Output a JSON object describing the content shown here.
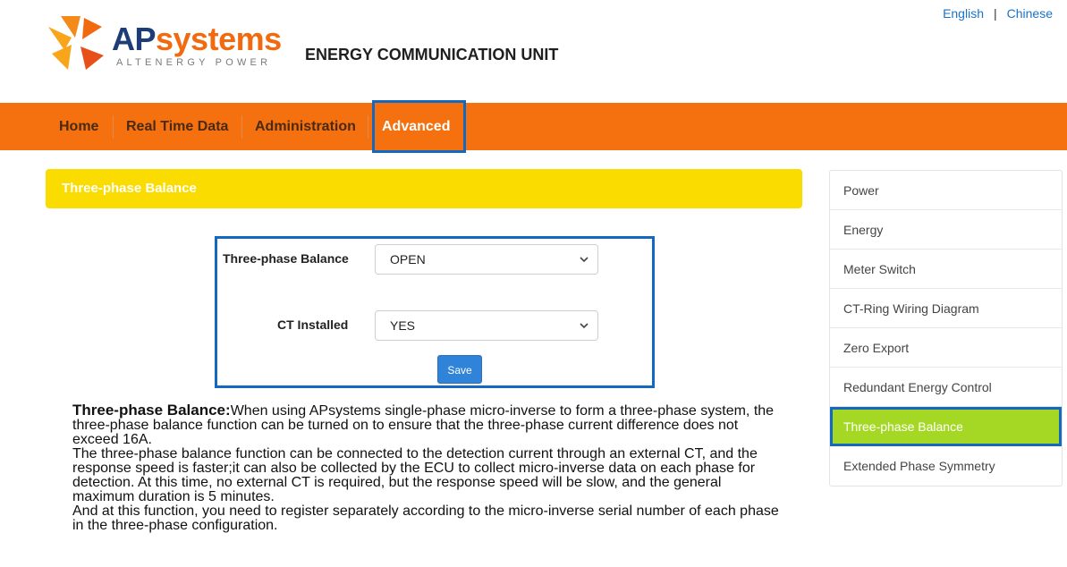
{
  "language": {
    "english": "English",
    "separator": "|",
    "chinese": "Chinese"
  },
  "brand": {
    "name_part1": "AP",
    "name_part2": "systems",
    "tagline": "ALTENERGY POWER",
    "product_title": "ENERGY COMMUNICATION UNIT",
    "colors": {
      "navy": "#1e3c78",
      "orange": "#f26a10",
      "yellow": "#f8a51b"
    }
  },
  "nav": {
    "items": [
      {
        "label": "Home"
      },
      {
        "label": "Real Time Data"
      },
      {
        "label": "Administration"
      },
      {
        "label": "Advanced",
        "active": true
      }
    ],
    "color": "#f5700f"
  },
  "section": {
    "title": "Three-phase Balance",
    "color": "#fadc00"
  },
  "form": {
    "balance_label": "Three-phase Balance",
    "balance_value": "OPEN",
    "ct_label": "CT Installed",
    "ct_value": "YES",
    "save_label": "Save"
  },
  "description": {
    "heading": "Three-phase Balance:",
    "para1": "When using APsystems single-phase micro-inverse to form a three-phase system, the three-phase balance function can be turned on to ensure that the three-phase current difference does not exceed 16A.",
    "para2": "The three-phase balance function can be connected to the detection current through an external CT, and the response speed is faster;it can also be collected by the ECU to collect micro-inverse data on each phase for detection. At this time, no external CT is required, but the response speed will be slow, and the general maximum duration is 5 minutes.",
    "para3": "And at this function, you need to register separately according to the micro-inverse serial number of each phase in the three-phase configuration."
  },
  "sidebar": {
    "items": [
      {
        "label": "Power"
      },
      {
        "label": "Energy"
      },
      {
        "label": "Meter Switch"
      },
      {
        "label": "CT-Ring Wiring Diagram"
      },
      {
        "label": "Zero Export"
      },
      {
        "label": "Redundant Energy Control"
      },
      {
        "label": "Three-phase Balance",
        "active": true
      },
      {
        "label": "Extended Phase Symmetry"
      }
    ],
    "active_color": "#a4d825"
  },
  "icons": {
    "logo": "apsystems-logo-icon",
    "select_arrow": "chevron-down-icon"
  }
}
